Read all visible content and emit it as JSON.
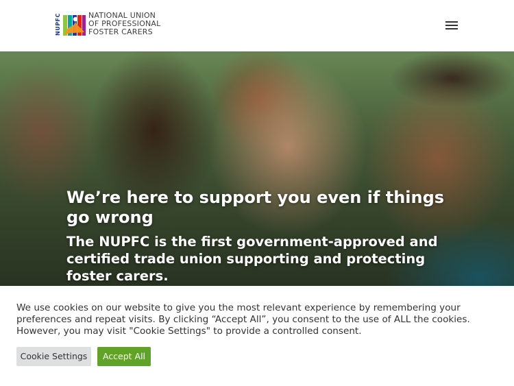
{
  "header": {
    "logo": {
      "abbr": "NUPFC",
      "lines": [
        "NATIONAL UNION",
        "OF PROFESSIONAL",
        "FOSTER CARERS"
      ],
      "colors": [
        "#e2231a",
        "#f7941d",
        "#8dc63f",
        "#00a99d",
        "#2e3192",
        "#92278f"
      ]
    },
    "menu_icon": "hamburger-menu-icon"
  },
  "hero": {
    "heading": "We’re here to support you even if things go wrong",
    "subheading": "The NUPFC is the first government-approved and certified trade union supporting and protecting foster carers."
  },
  "cookie_banner": {
    "text": "We use cookies on our website to give you the most relevant experience by remembering your preferences and repeat visits. By clicking “Accept All”, you consent to the use of ALL the cookies. However, you may visit \"Cookie Settings\" to provide a controlled consent.",
    "settings_label": "Cookie Settings",
    "accept_label": "Accept All",
    "accent_color": "#61a229"
  }
}
